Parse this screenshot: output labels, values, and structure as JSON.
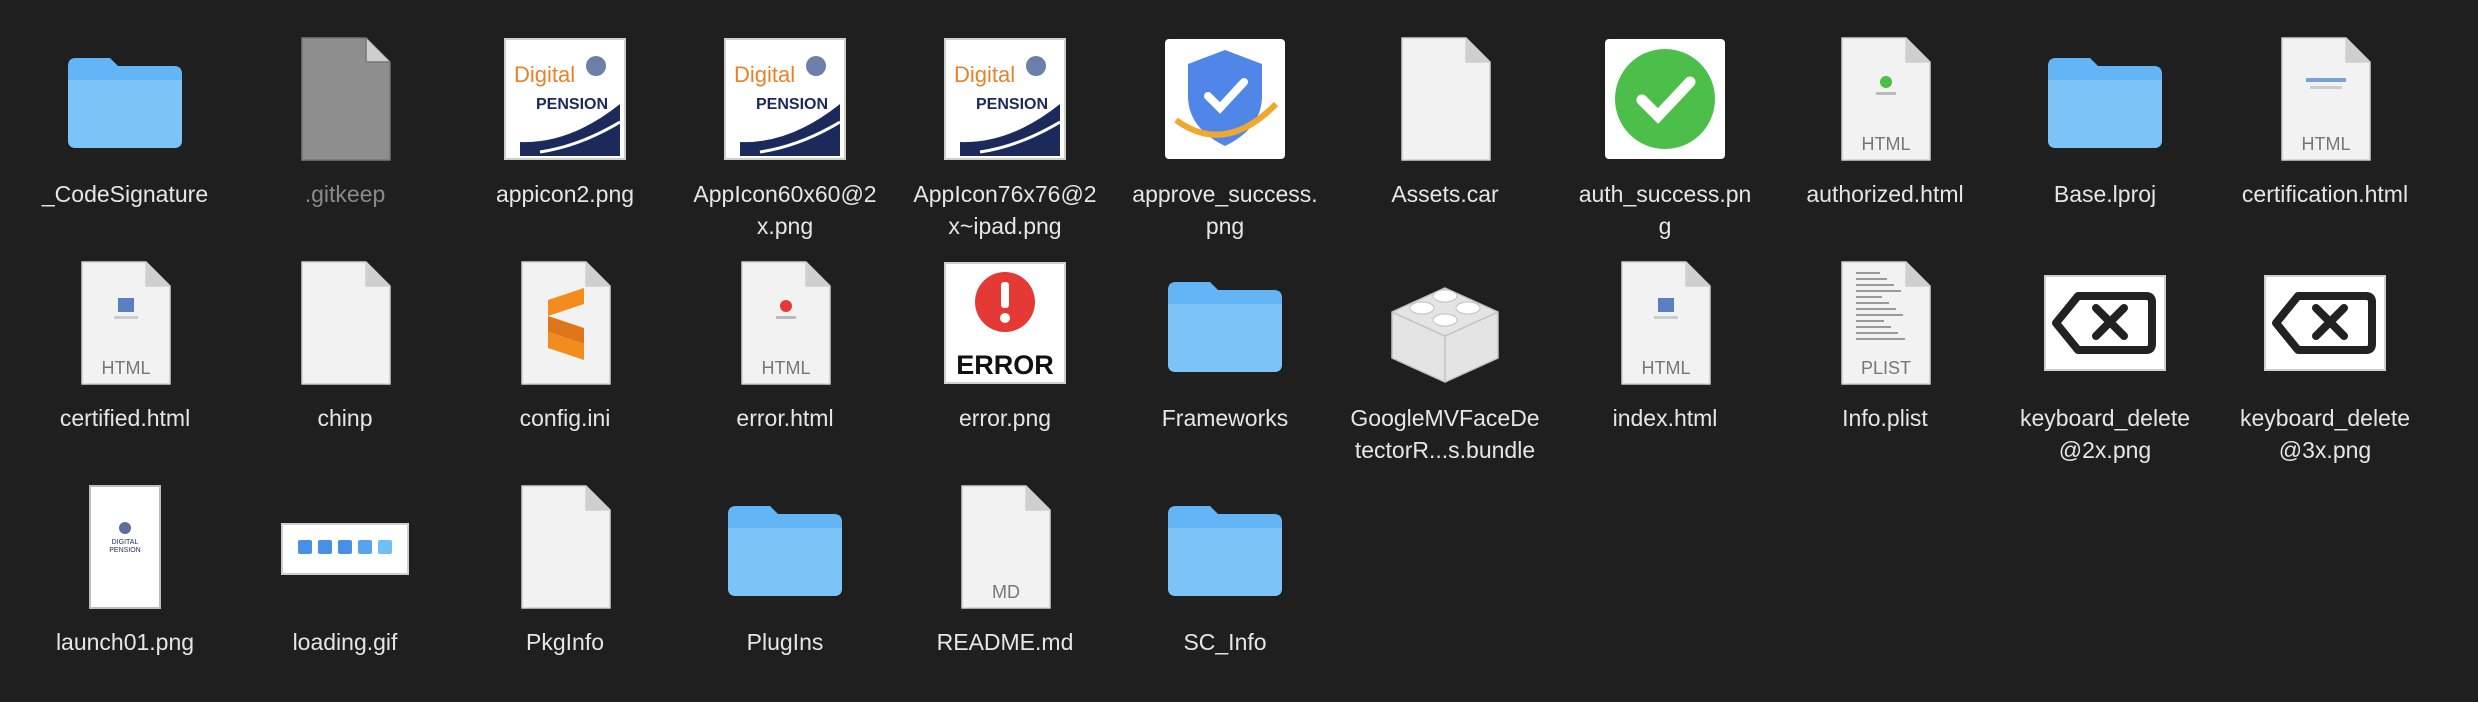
{
  "window": {
    "background": "#1f1f1f",
    "text_color": "#e6e6e6",
    "folder_color": "#64b5f6"
  },
  "items": [
    {
      "label": "_CodeSignature",
      "kind": "folder",
      "icon": "folder-icon",
      "dim": false
    },
    {
      "label": ".gitkeep",
      "kind": "gitkeep",
      "icon": "hidden-file-icon",
      "dim": true
    },
    {
      "label": "appicon2.png",
      "kind": "pension",
      "icon": "digital-pension-logo-icon",
      "dim": false,
      "logo_top": "Digital",
      "logo_bottom": "PENSION"
    },
    {
      "label": "AppIcon60x60@2\nx.png",
      "kind": "pension",
      "icon": "digital-pension-logo-icon",
      "dim": false,
      "logo_top": "Digital",
      "logo_bottom": "PENSION"
    },
    {
      "label": "AppIcon76x76@2\nx~ipad.png",
      "kind": "pension",
      "icon": "digital-pension-logo-icon",
      "dim": false,
      "logo_top": "Digital",
      "logo_bottom": "PENSION"
    },
    {
      "label": "approve_success.\npng",
      "kind": "shield",
      "icon": "shield-check-icon",
      "dim": false
    },
    {
      "label": "Assets.car",
      "kind": "doc",
      "icon": "document-icon",
      "dim": false
    },
    {
      "label": "auth_success.pn\ng",
      "kind": "check",
      "icon": "green-checkmark-icon",
      "dim": false
    },
    {
      "label": "authorized.html",
      "kind": "html-check",
      "icon": "html-file-icon",
      "dim": false,
      "tag": "HTML"
    },
    {
      "label": "Base.lproj",
      "kind": "folder",
      "icon": "folder-icon",
      "dim": false
    },
    {
      "label": "certification.html",
      "kind": "html-dots",
      "icon": "html-file-icon",
      "dim": false,
      "tag": "HTML"
    },
    {
      "label": "certified.html",
      "kind": "html-mini",
      "icon": "html-file-icon",
      "dim": false,
      "tag": "HTML"
    },
    {
      "label": "chinp",
      "kind": "doc",
      "icon": "document-icon",
      "dim": false
    },
    {
      "label": "config.ini",
      "kind": "sublime",
      "icon": "sublime-text-icon",
      "dim": false
    },
    {
      "label": "error.html",
      "kind": "html-red",
      "icon": "html-file-icon",
      "dim": false,
      "tag": "HTML"
    },
    {
      "label": "error.png",
      "kind": "error",
      "icon": "error-image-icon",
      "dim": false,
      "tag": "ERROR"
    },
    {
      "label": "Frameworks",
      "kind": "folder",
      "icon": "folder-icon",
      "dim": false
    },
    {
      "label": "GoogleMVFaceDe\ntectorR...s.bundle",
      "kind": "bundle",
      "icon": "bundle-lego-icon",
      "dim": false
    },
    {
      "label": "index.html",
      "kind": "html-mini",
      "icon": "html-file-icon",
      "dim": false,
      "tag": "HTML"
    },
    {
      "label": "Info.plist",
      "kind": "plist",
      "icon": "plist-file-icon",
      "dim": false,
      "tag": "PLIST"
    },
    {
      "label": "keyboard_delete\n@2x.png",
      "kind": "delete",
      "icon": "keyboard-delete-icon",
      "dim": false
    },
    {
      "label": "keyboard_delete\n@3x.png",
      "kind": "delete",
      "icon": "keyboard-delete-icon",
      "dim": false
    },
    {
      "label": "launch01.png",
      "kind": "launch",
      "icon": "launch-screen-icon",
      "dim": false,
      "logo_top": "DIGITAL",
      "logo_bottom": "PENSION"
    },
    {
      "label": "loading.gif",
      "kind": "loading",
      "icon": "loading-dots-icon",
      "dim": false
    },
    {
      "label": "PkgInfo",
      "kind": "doc",
      "icon": "document-icon",
      "dim": false
    },
    {
      "label": "PlugIns",
      "kind": "folder",
      "icon": "folder-icon",
      "dim": false
    },
    {
      "label": "README.md",
      "kind": "md",
      "icon": "markdown-file-icon",
      "dim": false,
      "tag": "MD"
    },
    {
      "label": "SC_Info",
      "kind": "folder",
      "icon": "folder-icon",
      "dim": false
    }
  ]
}
